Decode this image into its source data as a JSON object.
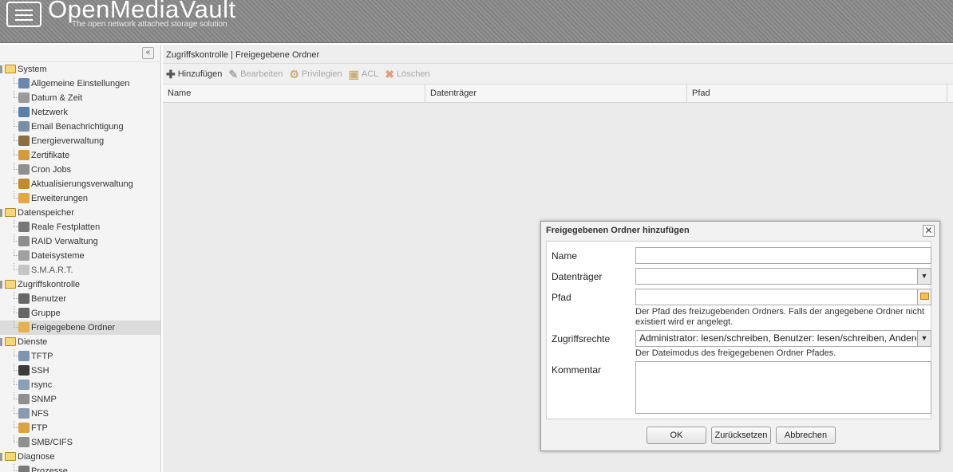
{
  "header": {
    "title": "OpenMediaVault",
    "subtitle": "The open network attached storage solution"
  },
  "sidebar": {
    "collapse_icon": "double-chevron-left-icon",
    "groups": [
      {
        "label": "System",
        "items": [
          {
            "label": "Allgemeine Einstellungen",
            "icon": "wrench-icon",
            "color": "#6b86b0"
          },
          {
            "label": "Datum & Zeit",
            "icon": "clock-icon",
            "color": "#9a9a9a"
          },
          {
            "label": "Netzwerk",
            "icon": "network-icon",
            "color": "#5a7fa8"
          },
          {
            "label": "Email Benachrichtigung",
            "icon": "email-icon",
            "color": "#7a8fa6"
          },
          {
            "label": "Energieverwaltung",
            "icon": "power-icon",
            "color": "#8a7040"
          },
          {
            "label": "Zertifikate",
            "icon": "certificate-icon",
            "color": "#d49a3c"
          },
          {
            "label": "Cron Jobs",
            "icon": "cron-icon",
            "color": "#8f8f8f"
          },
          {
            "label": "Aktualisierungsverwaltung",
            "icon": "update-icon",
            "color": "#c08a30"
          },
          {
            "label": "Erweiterungen",
            "icon": "puzzle-icon",
            "color": "#e1a840"
          }
        ]
      },
      {
        "label": "Datenspeicher",
        "items": [
          {
            "label": "Reale Festplatten",
            "icon": "disk-icon",
            "color": "#777777"
          },
          {
            "label": "RAID Verwaltung",
            "icon": "raid-icon",
            "color": "#8d8d8d"
          },
          {
            "label": "Dateisysteme",
            "icon": "filesystem-icon",
            "color": "#a0a0a0"
          },
          {
            "label": "S.M.A.R.T.",
            "icon": "smart-icon",
            "color": "#c5c5c5"
          }
        ]
      },
      {
        "label": "Zugriffskontrolle",
        "items": [
          {
            "label": "Benutzer",
            "icon": "user-icon",
            "color": "#666666"
          },
          {
            "label": "Gruppe",
            "icon": "group-icon",
            "color": "#666666"
          },
          {
            "label": "Freigegebene Ordner",
            "icon": "shared-folder-icon",
            "color": "#e6b34a"
          }
        ]
      },
      {
        "label": "Dienste",
        "items": [
          {
            "label": "TFTP",
            "icon": "tftp-icon",
            "color": "#7f95ad"
          },
          {
            "label": "SSH",
            "icon": "terminal-icon",
            "color": "#3b3b3b"
          },
          {
            "label": "rsync",
            "icon": "rsync-icon",
            "color": "#8aa0b8"
          },
          {
            "label": "SNMP",
            "icon": "snmp-icon",
            "color": "#8f8f8f"
          },
          {
            "label": "NFS",
            "icon": "nfs-icon",
            "color": "#8a9bb0"
          },
          {
            "label": "FTP",
            "icon": "ftp-icon",
            "color": "#d9a441"
          },
          {
            "label": "SMB/CIFS",
            "icon": "smb-icon",
            "color": "#8f8f8f"
          }
        ]
      },
      {
        "label": "Diagnose",
        "items": [
          {
            "label": "Prozesse",
            "icon": "process-icon",
            "color": "#7a7a7a"
          }
        ]
      }
    ]
  },
  "main": {
    "breadcrumb": "Zugriffskontrolle | Freigegebene Ordner",
    "toolbar": [
      {
        "label": "Hinzufügen",
        "icon": "plus-icon",
        "enabled": true,
        "color": "#555555"
      },
      {
        "label": "Bearbeiten",
        "icon": "edit-icon",
        "enabled": false,
        "color": "#aaaaaa"
      },
      {
        "label": "Privilegien",
        "icon": "privileges-icon",
        "enabled": false,
        "color": "#c9b27a"
      },
      {
        "label": "ACL",
        "icon": "acl-icon",
        "enabled": false,
        "color": "#c9b27a"
      },
      {
        "label": "Löschen",
        "icon": "delete-icon",
        "enabled": false,
        "color": "#e0a080"
      }
    ],
    "grid_columns": [
      "Name",
      "Datenträger",
      "Pfad"
    ]
  },
  "dialog": {
    "title": "Freigegebenen Ordner hinzufügen",
    "close_icon": "close-icon",
    "fields": {
      "name": {
        "label": "Name",
        "value": ""
      },
      "volume": {
        "label": "Datenträger",
        "value": ""
      },
      "path": {
        "label": "Pfad",
        "value": "",
        "help": "Der Pfad des freizugebenden Ordners. Falls der angegebene Ordner nicht existiert wird er angelegt."
      },
      "permissions": {
        "label": "Zugriffsrechte",
        "value": "Administrator: lesen/schreiben, Benutzer: lesen/schreiben, Andere: nur lesen",
        "help": "Der Dateimodus des freigegebenen Ordner Pfades."
      },
      "comment": {
        "label": "Kommentar",
        "value": ""
      }
    },
    "buttons": {
      "ok": "OK",
      "reset": "Zurücksetzen",
      "cancel": "Abbrechen"
    }
  }
}
